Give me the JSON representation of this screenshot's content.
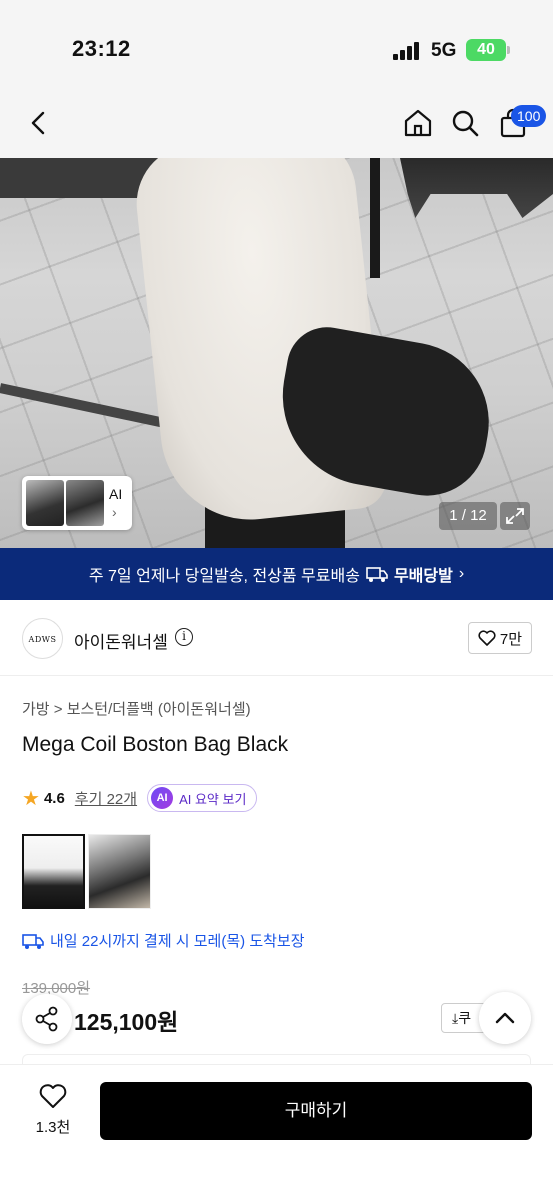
{
  "status_bar": {
    "time": "23:12",
    "network": "5G",
    "battery": "40"
  },
  "header": {
    "cart_count": "100"
  },
  "gallery": {
    "counter": "1 / 12",
    "ai_label": "AI"
  },
  "banner": {
    "text": "주 7일 언제나 당일발송, 전상품 무료배송",
    "brand": "무배당발"
  },
  "seller": {
    "logo_text": "ADWS",
    "name": "아이돈워너셀",
    "like_count": "7만"
  },
  "product": {
    "breadcrumb": "가방 > 보스턴/더플백 (아이돈워너셀)",
    "title": "Mega Coil Boston Bag Black",
    "rating": "4.6",
    "reviews": "후기 22개",
    "ai_summary": "AI 요약 보기",
    "ai_badge": "AI",
    "arrival": "내일 22시까지 결제 시 모레(목) 도착보장",
    "original_price": "139,000원",
    "sale_price": "125,100원",
    "coupon_label": "쿠"
  },
  "bottom_bar": {
    "wish_count": "1.3천",
    "buy_label": "구매하기"
  },
  "colors": {
    "banner_bg": "#0b2a7a",
    "accent_blue": "#1a55e6",
    "ai_purple": "#5b2ac7",
    "star": "#f5a623"
  }
}
